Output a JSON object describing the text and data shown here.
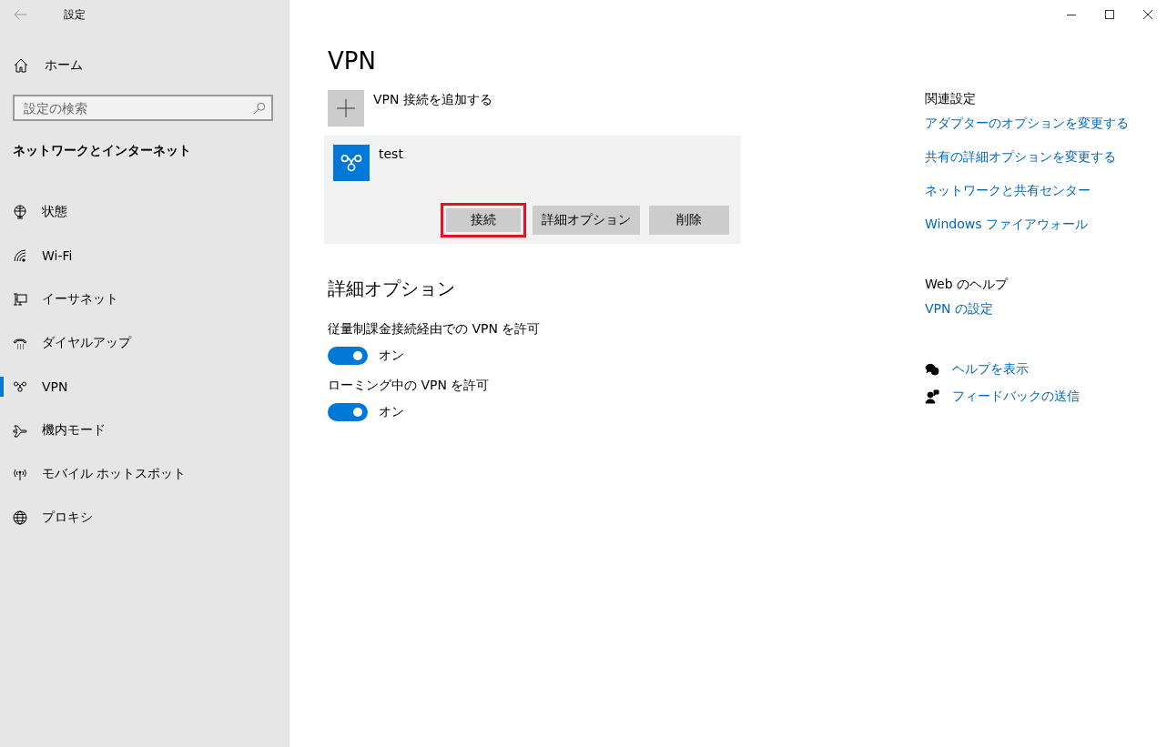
{
  "window": {
    "title": "設定"
  },
  "sidebar": {
    "home": "ホーム",
    "search": {
      "placeholder": "設定の検索"
    },
    "heading": "ネットワークとインターネット",
    "items": [
      {
        "kind": "status",
        "label": "状態",
        "selected": false
      },
      {
        "kind": "wifi",
        "label": "Wi-Fi",
        "selected": false
      },
      {
        "kind": "ethernet",
        "label": "イーサネット",
        "selected": false
      },
      {
        "kind": "dialup",
        "label": "ダイヤルアップ",
        "selected": false
      },
      {
        "kind": "vpn",
        "label": "VPN",
        "selected": true
      },
      {
        "kind": "airplane",
        "label": "機内モード",
        "selected": false
      },
      {
        "kind": "hotspot",
        "label": "モバイル ホットスポット",
        "selected": false
      },
      {
        "kind": "proxy",
        "label": "プロキシ",
        "selected": false
      }
    ]
  },
  "main": {
    "title": "VPN",
    "add_label": "VPN 接続を追加する",
    "connections": [
      {
        "name": "test",
        "buttons": [
          {
            "label": "接続",
            "highlighted": true
          },
          {
            "label": "詳細オプション",
            "highlighted": false
          },
          {
            "label": "削除",
            "highlighted": false
          }
        ]
      }
    ],
    "advanced": {
      "heading": "詳細オプション",
      "toggles": [
        {
          "label": "従量制課金接続経由での VPN を許可",
          "on": true,
          "state_text": "オン"
        },
        {
          "label": "ローミング中の VPN を許可",
          "on": true,
          "state_text": "オン"
        }
      ]
    }
  },
  "related": {
    "heading": "関連設定",
    "links": [
      "アダプターのオプションを変更する",
      "共有の詳細オプションを変更する",
      "ネットワークと共有センター",
      "Windows ファイアウォール"
    ]
  },
  "web_help": {
    "heading": "Web のヘルプ",
    "links": [
      "VPN の設定"
    ]
  },
  "support": [
    {
      "kind": "help",
      "label": "ヘルプを表示"
    },
    {
      "kind": "feedback",
      "label": "フィードバックの送信"
    }
  ]
}
